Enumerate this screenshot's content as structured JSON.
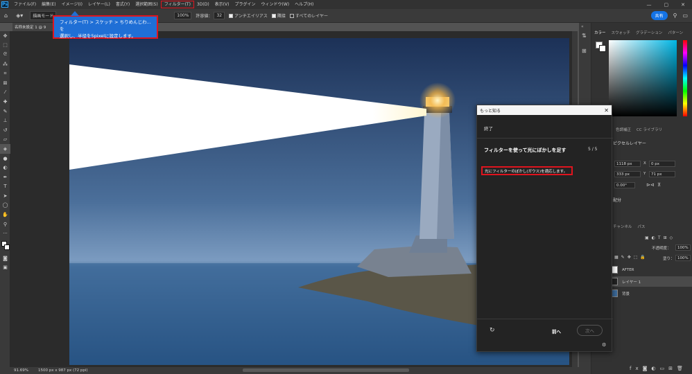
{
  "menubar": {
    "app_icon": "Ps",
    "items": [
      "ファイル(F)",
      "編集(E)",
      "イメージ(I)",
      "レイヤー(L)",
      "書式(Y)",
      "選択範囲(S)",
      "フィルター(T)",
      "3D(D)",
      "表示(V)",
      "プラグイン",
      "ウィンドウ(W)",
      "ヘルプ(H)"
    ],
    "highlighted_item": "フィルター(T)",
    "window_buttons": [
      "—",
      "▢",
      "✕"
    ]
  },
  "optionsbar": {
    "mode_label": "描画モード",
    "opacity": "100%",
    "tolerance_label": "許容値：",
    "tolerance": "32",
    "antialias": "アンチエイリアス",
    "contiguous": "隣接",
    "all_layers": "すべてのレイヤー",
    "share": "共有"
  },
  "document": {
    "tab": "名称未設定 1 @ 9",
    "zoom": "91.69%",
    "info": "1500 px x 987 px (72 ppi)"
  },
  "callout": {
    "line1": "フィルター(T) > スケッチ > ちりめんじわ...を",
    "line2": "選択し、半径を5pixelに設定します。"
  },
  "color_panel": {
    "tabs": [
      "カラー",
      "スウォッチ",
      "グラデーション",
      "パターン"
    ],
    "active_tab": "カラー"
  },
  "properties": {
    "tabs": [
      "色調補正",
      "CC ライブラリ"
    ],
    "title": "ピクセルレイヤー",
    "w": "1118 px",
    "x_label": "X",
    "x": "0 px",
    "h": "333 px",
    "y_label": "Y",
    "y": "71 px",
    "angle": "0.00°",
    "section": "配分"
  },
  "layers": {
    "tabs": [
      "チャンネル",
      "パス"
    ],
    "opacity_label": "不透明度：",
    "opacity": "100%",
    "fill_label": "塗り：",
    "fill": "100%",
    "items": [
      {
        "name": "AFTER",
        "selected": false
      },
      {
        "name": "レイヤー 1",
        "selected": true
      },
      {
        "name": "背景",
        "selected": false
      }
    ]
  },
  "dialog": {
    "title": "もっと知る",
    "done": "終了",
    "step_title": "フィルターを使って光にぼかしを足す",
    "step_count": "5 / 5",
    "instruction": "光にフィルターのぼかし(ガウス)を適応します。",
    "prev": "前へ",
    "next": "次へ"
  }
}
